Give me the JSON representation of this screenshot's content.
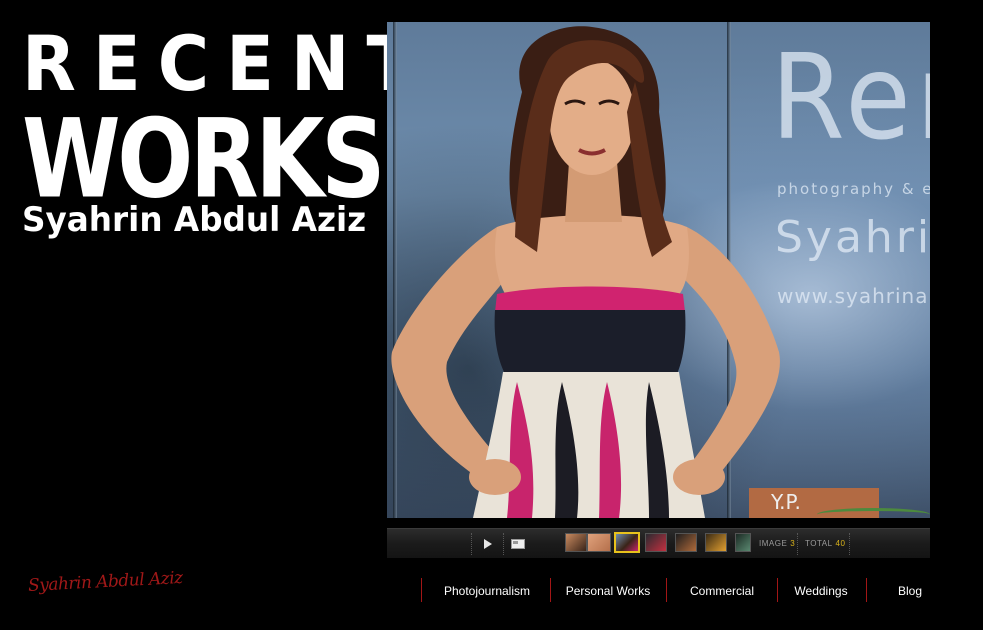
{
  "header": {
    "title_line1": "RECENT",
    "title_line2": "WORKS",
    "subtitle": "Syahrin Abdul Aziz"
  },
  "photo": {
    "watermark_large": "Ren",
    "watermark_small": "photography & e",
    "watermark_mid": "Syahrin",
    "watermark_url": "www.syahrina",
    "sign_text": "Y.P."
  },
  "gallery": {
    "play_icon": "play-icon",
    "fullscreen_icon": "fullscreen-icon",
    "image_label": "IMAGE",
    "image_number": "3",
    "total_label": "TOTAL",
    "total_number": "40",
    "active_index": 2,
    "thumb_count": 7,
    "accent_color": "#e8c21c"
  },
  "footer": {
    "signature": "Syahrin Abdul Aziz",
    "signature_color": "#a01818",
    "nav": [
      {
        "label": "Photojournalism"
      },
      {
        "label": "Personal Works"
      },
      {
        "label": "Commercial"
      },
      {
        "label": "Weddings"
      },
      {
        "label": "Blog"
      }
    ],
    "divider_color": "#a31616"
  }
}
